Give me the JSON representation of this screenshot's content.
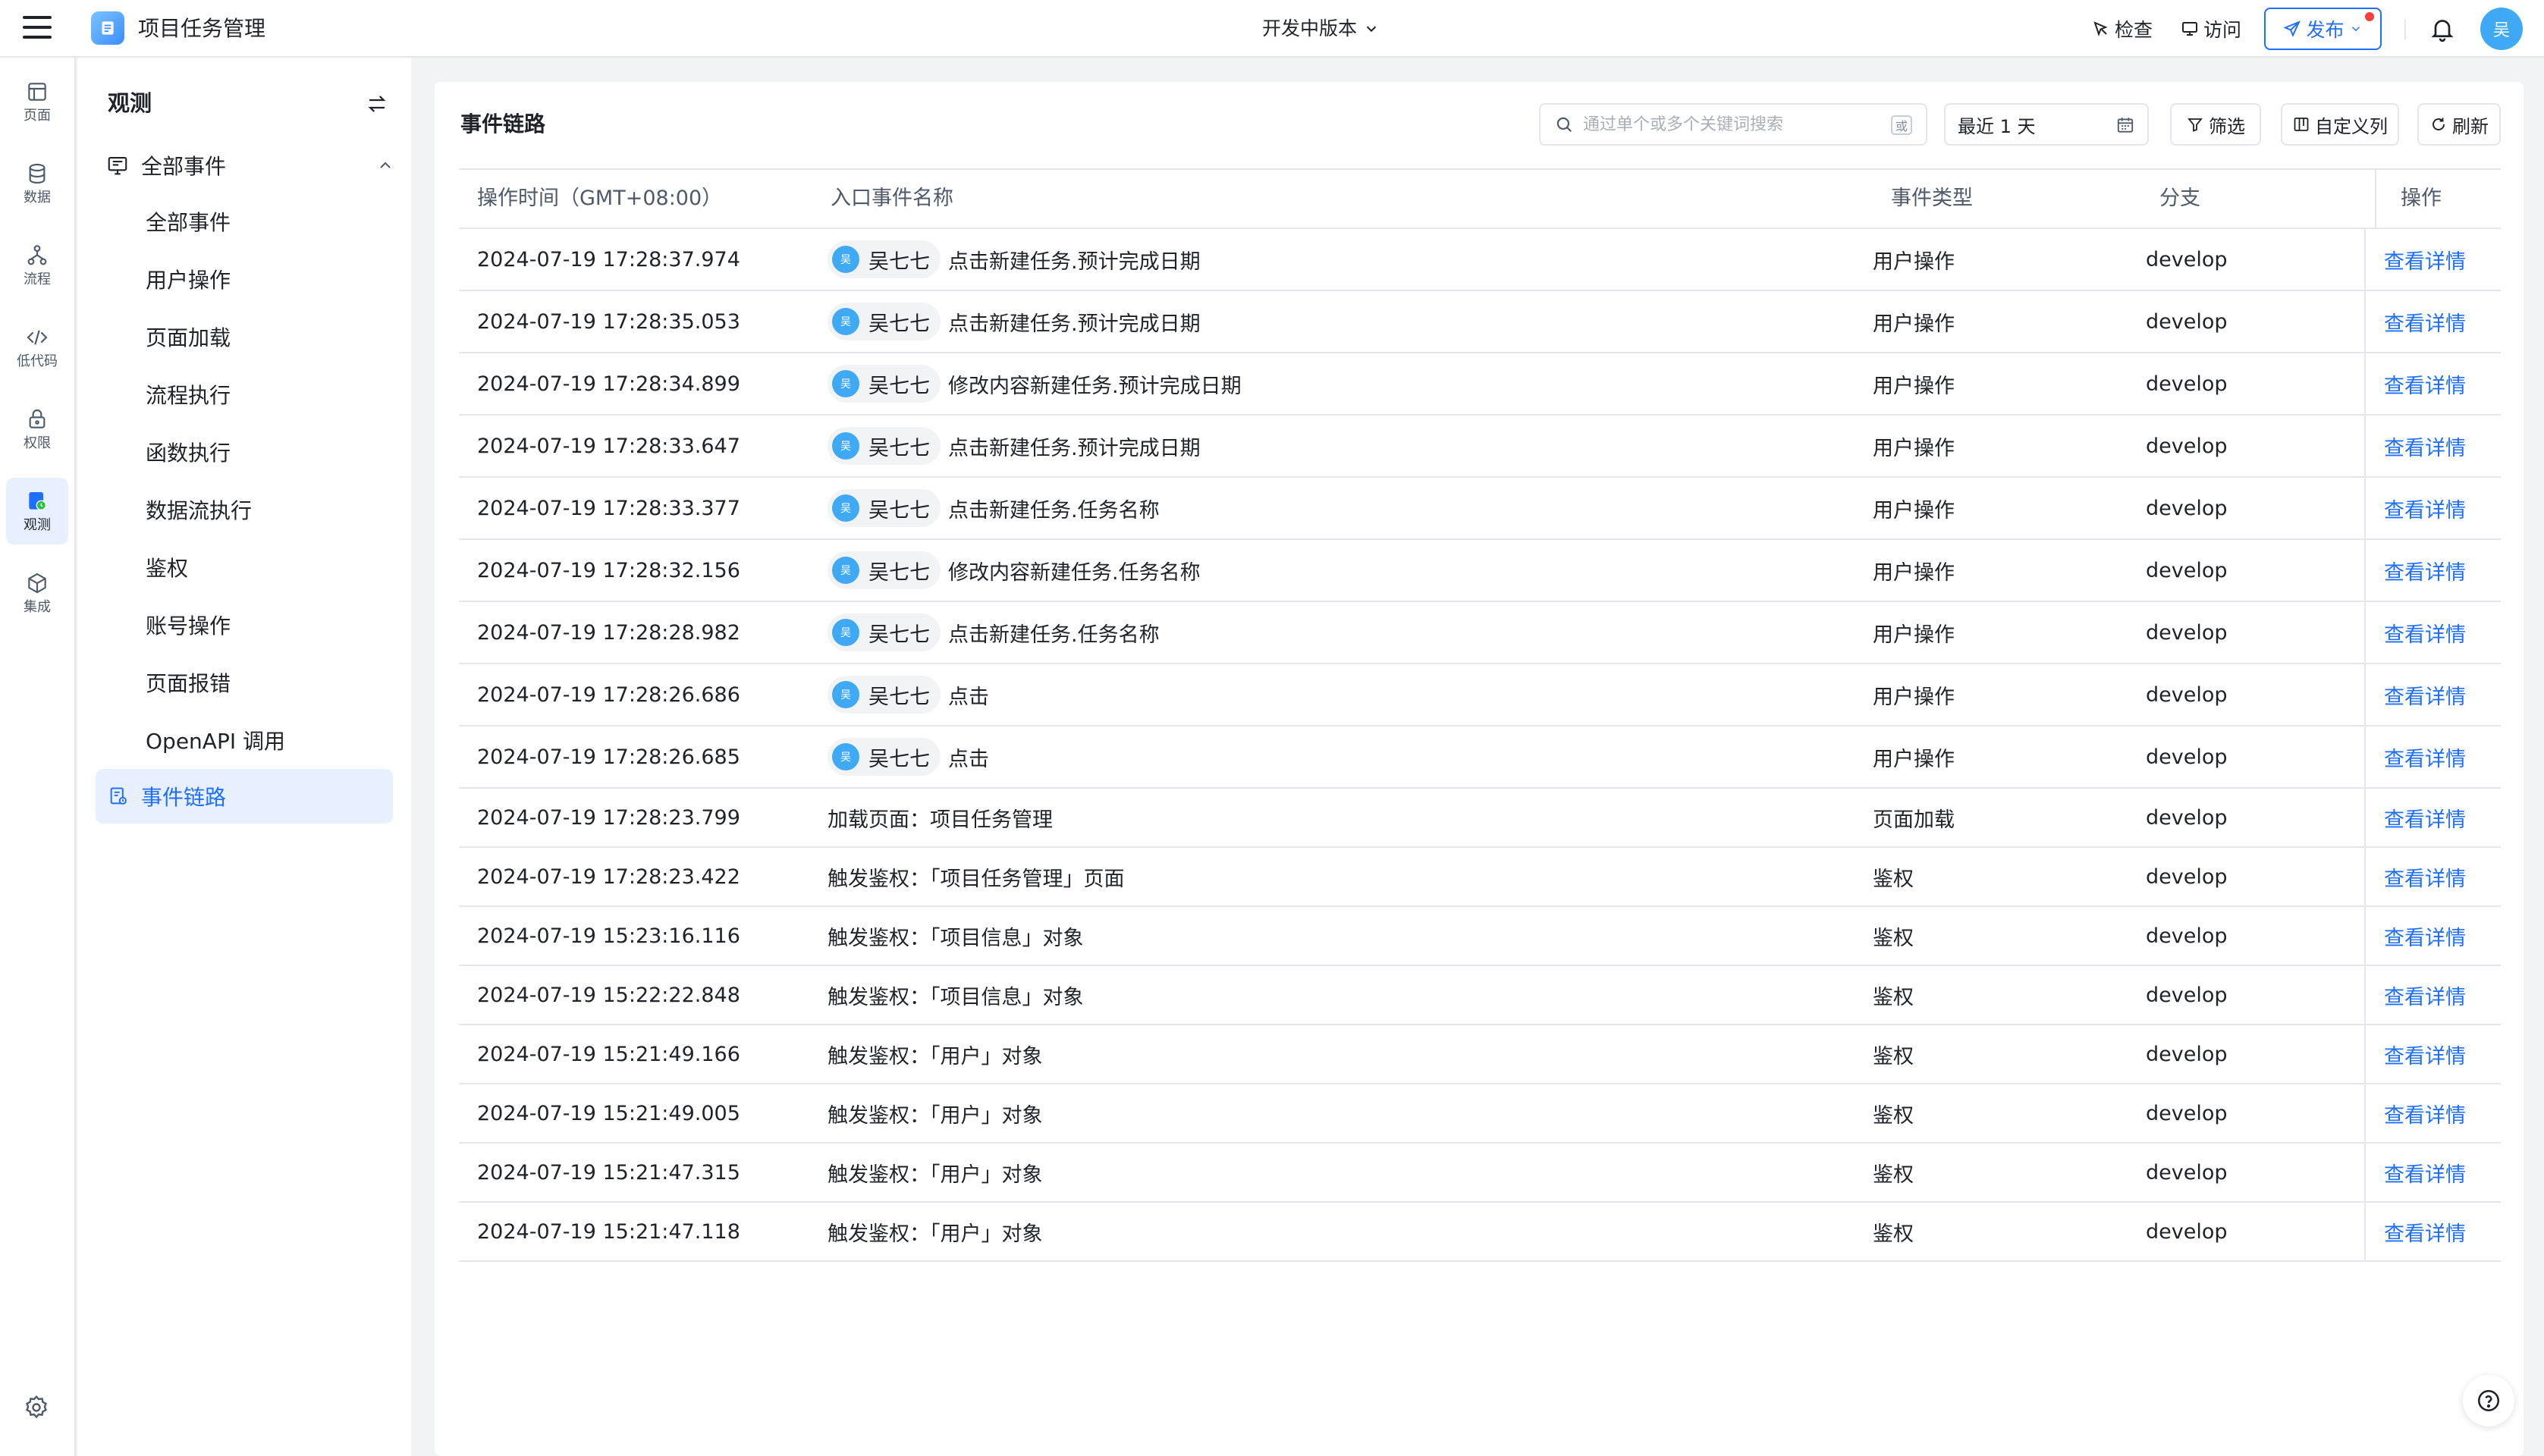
{
  "header": {
    "app_title": "项目任务管理",
    "version_label": "开发中版本",
    "check_label": "检查",
    "visit_label": "访问",
    "publish_label": "发布",
    "user_avatar_text": "吴"
  },
  "rail": {
    "items": [
      {
        "label": "页面",
        "icon": "page-icon"
      },
      {
        "label": "数据",
        "icon": "database-icon"
      },
      {
        "label": "流程",
        "icon": "flow-icon"
      },
      {
        "label": "低代码",
        "icon": "code-icon"
      },
      {
        "label": "权限",
        "icon": "lock-icon"
      },
      {
        "label": "观测",
        "icon": "observe-icon",
        "active": true
      },
      {
        "label": "集成",
        "icon": "cube-icon"
      }
    ],
    "settings_icon": "gear-icon"
  },
  "sidebar": {
    "title": "观测",
    "group_label": "全部事件",
    "items": [
      {
        "label": "全部事件"
      },
      {
        "label": "用户操作"
      },
      {
        "label": "页面加载"
      },
      {
        "label": "流程执行"
      },
      {
        "label": "函数执行"
      },
      {
        "label": "数据流执行"
      },
      {
        "label": "鉴权"
      },
      {
        "label": "账号操作"
      },
      {
        "label": "页面报错"
      },
      {
        "label": "OpenAPI 调用"
      }
    ],
    "active_item": {
      "label": "事件链路"
    }
  },
  "main": {
    "title": "事件链路",
    "search_placeholder": "通过单个或多个关键词搜索",
    "search_or_badge": "或",
    "date_range": "最近 1 天",
    "filter_label": "筛选",
    "columns_label": "自定义列",
    "refresh_label": "刷新",
    "accent_color": "#1e6fff",
    "columns": {
      "time": "操作时间（GMT+08:00）",
      "name": "入口事件名称",
      "type": "事件类型",
      "branch": "分支",
      "action": "操作"
    },
    "rows": [
      {
        "time": "2024-07-19 17:28:37.974",
        "user": "吴七七",
        "avatar": "吴",
        "name": "点击新建任务.预计完成日期",
        "type": "用户操作",
        "branch": "develop",
        "action": "查看详情"
      },
      {
        "time": "2024-07-19 17:28:35.053",
        "user": "吴七七",
        "avatar": "吴",
        "name": "点击新建任务.预计完成日期",
        "type": "用户操作",
        "branch": "develop",
        "action": "查看详情"
      },
      {
        "time": "2024-07-19 17:28:34.899",
        "user": "吴七七",
        "avatar": "吴",
        "name": "修改内容新建任务.预计完成日期",
        "type": "用户操作",
        "branch": "develop",
        "action": "查看详情"
      },
      {
        "time": "2024-07-19 17:28:33.647",
        "user": "吴七七",
        "avatar": "吴",
        "name": "点击新建任务.预计完成日期",
        "type": "用户操作",
        "branch": "develop",
        "action": "查看详情"
      },
      {
        "time": "2024-07-19 17:28:33.377",
        "user": "吴七七",
        "avatar": "吴",
        "name": "点击新建任务.任务名称",
        "type": "用户操作",
        "branch": "develop",
        "action": "查看详情"
      },
      {
        "time": "2024-07-19 17:28:32.156",
        "user": "吴七七",
        "avatar": "吴",
        "name": "修改内容新建任务.任务名称",
        "type": "用户操作",
        "branch": "develop",
        "action": "查看详情"
      },
      {
        "time": "2024-07-19 17:28:28.982",
        "user": "吴七七",
        "avatar": "吴",
        "name": "点击新建任务.任务名称",
        "type": "用户操作",
        "branch": "develop",
        "action": "查看详情"
      },
      {
        "time": "2024-07-19 17:28:26.686",
        "user": "吴七七",
        "avatar": "吴",
        "name": "点击",
        "type": "用户操作",
        "branch": "develop",
        "action": "查看详情"
      },
      {
        "time": "2024-07-19 17:28:26.685",
        "user": "吴七七",
        "avatar": "吴",
        "name": "点击",
        "type": "用户操作",
        "branch": "develop",
        "action": "查看详情"
      },
      {
        "time": "2024-07-19 17:28:23.799",
        "name": "加载页面：项目任务管理",
        "type": "页面加载",
        "branch": "develop",
        "action": "查看详情"
      },
      {
        "time": "2024-07-19 17:28:23.422",
        "name": "触发鉴权：「项目任务管理」页面",
        "type": "鉴权",
        "branch": "develop",
        "action": "查看详情"
      },
      {
        "time": "2024-07-19 15:23:16.116",
        "name": "触发鉴权：「项目信息」对象",
        "type": "鉴权",
        "branch": "develop",
        "action": "查看详情"
      },
      {
        "time": "2024-07-19 15:22:22.848",
        "name": "触发鉴权：「项目信息」对象",
        "type": "鉴权",
        "branch": "develop",
        "action": "查看详情"
      },
      {
        "time": "2024-07-19 15:21:49.166",
        "name": "触发鉴权：「用户」对象",
        "type": "鉴权",
        "branch": "develop",
        "action": "查看详情"
      },
      {
        "time": "2024-07-19 15:21:49.005",
        "name": "触发鉴权：「用户」对象",
        "type": "鉴权",
        "branch": "develop",
        "action": "查看详情"
      },
      {
        "time": "2024-07-19 15:21:47.315",
        "name": "触发鉴权：「用户」对象",
        "type": "鉴权",
        "branch": "develop",
        "action": "查看详情"
      },
      {
        "time": "2024-07-19 15:21:47.118",
        "name": "触发鉴权：「用户」对象",
        "type": "鉴权",
        "branch": "develop",
        "action": "查看详情"
      }
    ]
  }
}
